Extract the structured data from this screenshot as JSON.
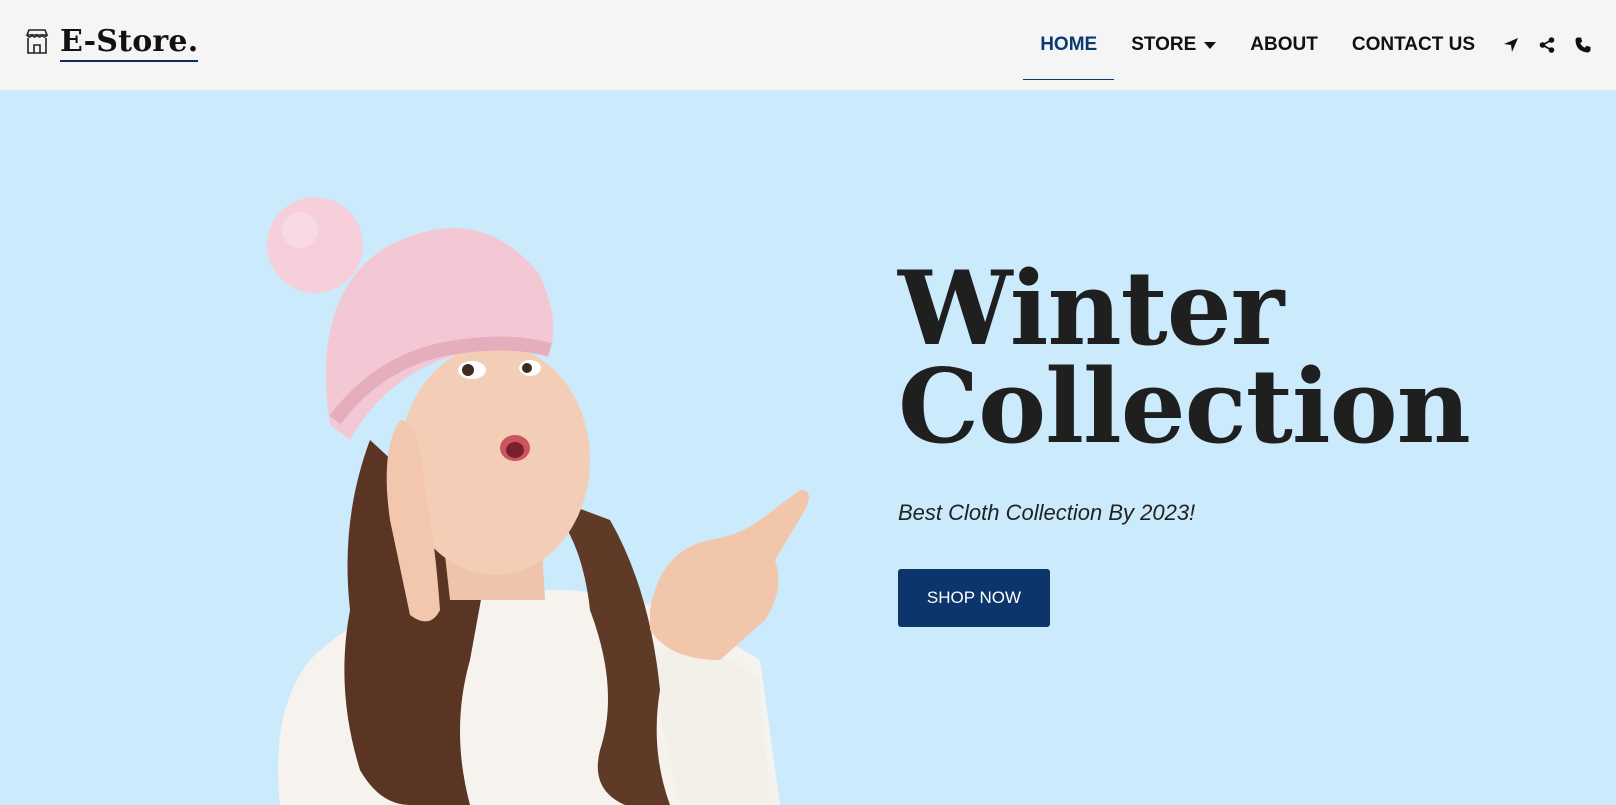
{
  "brand": {
    "name": "E-Store.",
    "icon": "storefront-icon"
  },
  "nav": {
    "items": [
      {
        "label": "HOME",
        "active": true
      },
      {
        "label": "STORE",
        "has_dropdown": true
      },
      {
        "label": "ABOUT"
      },
      {
        "label": "CONTACT US"
      }
    ],
    "icons": [
      "location-arrow-icon",
      "share-icon",
      "phone-icon"
    ],
    "accent_color": "#0b3a73"
  },
  "hero": {
    "title_line1": "Winter",
    "title_line2": "Collection",
    "subtitle": "Best Cloth Collection By 2023!",
    "cta_label": "SHOP NOW",
    "background_color": "#cbebfc",
    "button_color": "#0b356b"
  }
}
